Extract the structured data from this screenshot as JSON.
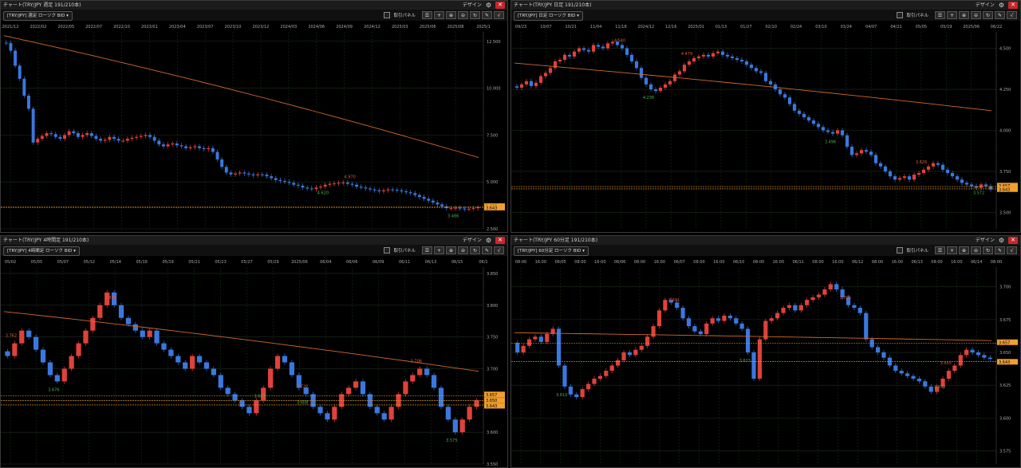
{
  "panes": [
    {
      "title": "チャート(TRY/JPY 週足 191/210本)",
      "symbol": "[TRY/JPY] 週足 ローソク BID",
      "design": "デザイン",
      "panel_label": "取引パネル",
      "xticks": [
        "2021/12",
        "2022/02",
        "2022/05",
        "2022/07",
        "2022/10",
        "2023/01",
        "2023/04",
        "2023/07",
        "2023/10",
        "2023/12",
        "2024/03",
        "2024/06",
        "2024/09",
        "2024/12",
        "2025/03",
        "2025/06",
        "2025/08",
        "2025/1"
      ],
      "yticks": [
        "12.500",
        "10.000",
        "7.500",
        "5.000",
        "2.500"
      ],
      "price_tags": [
        "3.657",
        "3.643"
      ],
      "annotations": [
        {
          "text": "4.620",
          "color": "#4caf50"
        },
        {
          "text": "4.970",
          "color": "#e05a3a"
        },
        {
          "text": "3.466",
          "color": "#4caf50"
        }
      ]
    },
    {
      "title": "チャート(TRY/JPY 日足 191/210本)",
      "symbol": "[TRY/JPY] 日足 ローソク BID",
      "design": "デザイン",
      "panel_label": "取引パネル",
      "xticks": [
        "09/23",
        "10/07",
        "10/21",
        "11/04",
        "11/18",
        "2024/12",
        "12/16",
        "2025/01",
        "01/13",
        "01/27",
        "02/10",
        "02/24",
        "03/10",
        "03/24",
        "04/07",
        "04/21",
        "05/05",
        "05/19",
        "2025/06",
        "06/22"
      ],
      "yticks": [
        "4.500",
        "4.250",
        "4.000",
        "3.750",
        "3.500"
      ],
      "price_tags": [
        "3.657",
        "3.643"
      ],
      "annotations": [
        {
          "text": "4.540",
          "color": "#e05a3a"
        },
        {
          "text": "4.479",
          "color": "#e05a3a"
        },
        {
          "text": "4.236",
          "color": "#4caf50"
        },
        {
          "text": "3.826",
          "color": "#e05a3a"
        },
        {
          "text": "3.496",
          "color": "#4caf50"
        },
        {
          "text": "3.572",
          "color": "#4caf50"
        }
      ]
    },
    {
      "title": "チャート(TRY/JPY 4時間足 191/210本)",
      "symbol": "[TRY/JPY] 4時間足 ローソク BID",
      "design": "デザイン",
      "panel_label": "取引パネル",
      "xticks": [
        "05/02",
        "05/05",
        "05/07",
        "05/12",
        "05/14",
        "05/16",
        "05/19",
        "05/21",
        "05/23",
        "05/27",
        "05/29",
        "2025/06",
        "06/04",
        "06/06",
        "06/09",
        "06/11",
        "06/13",
        "06/15",
        "06/1"
      ],
      "yticks": [
        "3.850",
        "3.800",
        "3.750",
        "3.700",
        "3.650",
        "3.600",
        "3.550"
      ],
      "price_tags": [
        "3.657",
        "3.650",
        "3.643"
      ],
      "annotations": [
        {
          "text": "3.762",
          "color": "#e05a3a"
        },
        {
          "text": "3.676",
          "color": "#4caf50"
        },
        {
          "text": "3.825",
          "color": "#e05a3a"
        },
        {
          "text": "3.722",
          "color": "#e05a3a"
        },
        {
          "text": "3.627",
          "color": "#4caf50"
        },
        {
          "text": "3.608",
          "color": "#4caf50"
        },
        {
          "text": "3.706",
          "color": "#e05a3a"
        },
        {
          "text": "3.575",
          "color": "#4caf50"
        }
      ]
    },
    {
      "title": "チャート(TRY/JPY 60分足 191/210本)",
      "symbol": "[TRY/JPY] 60分足 ローソク BID",
      "design": "デザイン",
      "panel_label": "取引パネル",
      "xticks": [
        "08:00",
        "16:00",
        "06/05",
        "08:00",
        "16:00",
        "06/06",
        "08:00",
        "16:00",
        "06/07",
        "08:00",
        "16:00",
        "06/10",
        "08:00",
        "16:00",
        "06/11",
        "08:00",
        "16:00",
        "06/12",
        "08:00",
        "16:00",
        "06/13",
        "08:00",
        "16:00",
        "06/14",
        "08:00"
      ],
      "yticks": [
        "3.700",
        "3.675",
        "3.650",
        "3.625",
        "3.600",
        "3.575"
      ],
      "price_tags": [
        "3.657",
        "3.643"
      ],
      "annotations": [
        {
          "text": "3.691",
          "color": "#e05a3a"
        },
        {
          "text": "3.706",
          "color": "#e05a3a"
        },
        {
          "text": "3.623",
          "color": "#4caf50"
        },
        {
          "text": "3.610",
          "color": "#4caf50"
        },
        {
          "text": "3.655",
          "color": "#e05a3a"
        },
        {
          "text": "3.572",
          "color": "#4caf50"
        }
      ]
    }
  ],
  "chart_data": [
    {
      "type": "candlestick",
      "title": "チャート(TRY/JPY 週足 191/210本)",
      "ylim": [
        2.5,
        13.0
      ],
      "close": [
        12.4,
        12.0,
        11.2,
        10.5,
        9.6,
        8.9,
        7.1,
        7.3,
        7.45,
        7.6,
        7.55,
        7.4,
        7.3,
        7.5,
        7.7,
        7.6,
        7.4,
        7.5,
        7.6,
        7.45,
        7.3,
        7.2,
        7.25,
        7.4,
        7.3,
        7.2,
        7.2,
        7.3,
        7.35,
        7.4,
        7.45,
        7.5,
        7.4,
        7.2,
        7.0,
        6.9,
        7.0,
        7.05,
        6.95,
        6.9,
        6.8,
        6.85,
        6.9,
        6.8,
        6.75,
        6.8,
        6.6,
        6.2,
        5.8,
        5.5,
        5.4,
        5.45,
        5.5,
        5.45,
        5.4,
        5.35,
        5.4,
        5.38,
        5.3,
        5.2,
        5.1,
        5.05,
        5.0,
        4.95,
        4.85,
        4.8,
        4.7,
        4.65,
        4.62,
        4.7,
        4.75,
        4.85,
        4.9,
        4.92,
        4.95,
        4.97,
        4.9,
        4.85,
        4.75,
        4.7,
        4.65,
        4.6,
        4.55,
        4.5,
        4.55,
        4.6,
        4.58,
        4.55,
        4.5,
        4.45,
        4.4,
        4.3,
        4.2,
        4.1,
        4.0,
        3.9,
        3.8,
        3.7,
        3.6,
        3.6,
        3.62,
        3.58,
        3.55,
        3.57,
        3.6,
        3.65
      ],
      "ma_series": [
        {
          "from": 12.8,
          "to": 6.3
        }
      ]
    },
    {
      "type": "candlestick",
      "title": "チャート(TRY/JPY 日足 191/210本)",
      "ylim": [
        3.4,
        4.6
      ],
      "close": [
        4.26,
        4.28,
        4.3,
        4.27,
        4.29,
        4.33,
        4.35,
        4.38,
        4.42,
        4.43,
        4.46,
        4.45,
        4.48,
        4.5,
        4.49,
        4.48,
        4.52,
        4.51,
        4.5,
        4.53,
        4.54,
        4.52,
        4.5,
        4.46,
        4.42,
        4.38,
        4.32,
        4.28,
        4.25,
        4.24,
        4.26,
        4.28,
        4.3,
        4.34,
        4.36,
        4.4,
        4.42,
        4.44,
        4.45,
        4.46,
        4.45,
        4.47,
        4.48,
        4.46,
        4.45,
        4.44,
        4.43,
        4.42,
        4.4,
        4.38,
        4.36,
        4.35,
        4.3,
        4.28,
        4.25,
        4.22,
        4.2,
        4.16,
        4.12,
        4.1,
        4.08,
        4.06,
        4.04,
        4.02,
        4.0,
        3.99,
        3.98,
        4.0,
        3.97,
        3.9,
        3.85,
        3.86,
        3.88,
        3.87,
        3.85,
        3.8,
        3.78,
        3.75,
        3.72,
        3.7,
        3.71,
        3.72,
        3.7,
        3.73,
        3.74,
        3.76,
        3.78,
        3.8,
        3.79,
        3.76,
        3.74,
        3.72,
        3.7,
        3.68,
        3.67,
        3.66,
        3.65,
        3.67,
        3.66,
        3.64
      ],
      "ma_series": [
        {
          "from": 4.41,
          "to": 4.12
        }
      ]
    },
    {
      "type": "candlestick",
      "title": "チャート(TRY/JPY 4時間足 191/210本)",
      "ylim": [
        3.55,
        3.86
      ],
      "close": [
        3.72,
        3.74,
        3.76,
        3.75,
        3.73,
        3.71,
        3.69,
        3.68,
        3.7,
        3.72,
        3.74,
        3.76,
        3.78,
        3.8,
        3.82,
        3.8,
        3.78,
        3.77,
        3.76,
        3.75,
        3.76,
        3.74,
        3.73,
        3.72,
        3.71,
        3.7,
        3.72,
        3.71,
        3.7,
        3.69,
        3.67,
        3.66,
        3.65,
        3.64,
        3.63,
        3.65,
        3.67,
        3.7,
        3.72,
        3.71,
        3.69,
        3.67,
        3.66,
        3.64,
        3.63,
        3.62,
        3.64,
        3.66,
        3.67,
        3.68,
        3.66,
        3.64,
        3.63,
        3.62,
        3.64,
        3.66,
        3.68,
        3.69,
        3.7,
        3.69,
        3.67,
        3.64,
        3.62,
        3.6,
        3.62,
        3.64,
        3.65
      ],
      "ma_series": [
        {
          "from": 3.79,
          "to": 3.696
        }
      ]
    },
    {
      "type": "candlestick",
      "title": "チャート(TRY/JPY 60分足 191/210本)",
      "ylim": [
        3.565,
        3.715
      ],
      "close": [
        3.65,
        3.655,
        3.66,
        3.662,
        3.658,
        3.664,
        3.668,
        3.64,
        3.624,
        3.618,
        3.616,
        3.622,
        3.626,
        3.63,
        3.632,
        3.636,
        3.64,
        3.644,
        3.65,
        3.648,
        3.652,
        3.655,
        3.662,
        3.67,
        3.682,
        3.69,
        3.688,
        3.684,
        3.676,
        3.67,
        3.666,
        3.664,
        3.672,
        3.676,
        3.674,
        3.678,
        3.676,
        3.672,
        3.668,
        3.65,
        3.63,
        3.66,
        3.674,
        3.676,
        3.68,
        3.684,
        3.686,
        3.682,
        3.686,
        3.69,
        3.692,
        3.694,
        3.698,
        3.702,
        3.698,
        3.692,
        3.686,
        3.684,
        3.68,
        3.66,
        3.654,
        3.65,
        3.646,
        3.64,
        3.636,
        3.634,
        3.632,
        3.63,
        3.628,
        3.624,
        3.62,
        3.624,
        3.63,
        3.636,
        3.64,
        3.648,
        3.652,
        3.65,
        3.648,
        3.646,
        3.645
      ],
      "ma_series": [
        {
          "from": 3.665,
          "to": 3.659
        }
      ]
    }
  ]
}
